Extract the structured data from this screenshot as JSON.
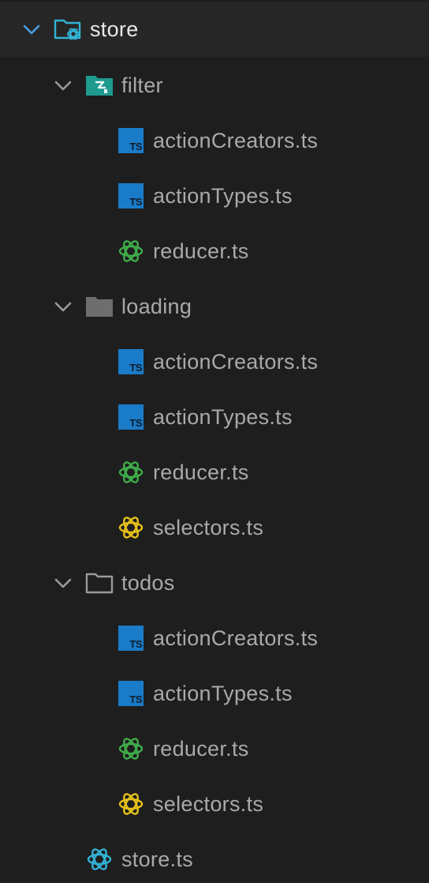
{
  "explorer": {
    "root": {
      "label": "store"
    },
    "filter": {
      "label": "filter",
      "files": [
        "actionCreators.ts",
        "actionTypes.ts",
        "reducer.ts"
      ]
    },
    "loading": {
      "label": "loading",
      "files": [
        "actionCreators.ts",
        "actionTypes.ts",
        "reducer.ts",
        "selectors.ts"
      ]
    },
    "todos": {
      "label": "todos",
      "files": [
        "actionCreators.ts",
        "actionTypes.ts",
        "reducer.ts",
        "selectors.ts"
      ]
    },
    "store_file": {
      "label": "store.ts"
    },
    "ts_badge_text": "TS"
  },
  "colors": {
    "background": "#1e1e1e",
    "root_row": "#262626",
    "chevron_root": "#4a9fe8",
    "chevron": "#9a9a9a",
    "typescript": "#1a7bc8",
    "redux_reducer": "#3fae49",
    "redux_selector": "#e8c21a",
    "redux_store": "#32b3d6",
    "folder_teal": "#1f9a8f",
    "folder_grey": "#6e6e6e"
  }
}
